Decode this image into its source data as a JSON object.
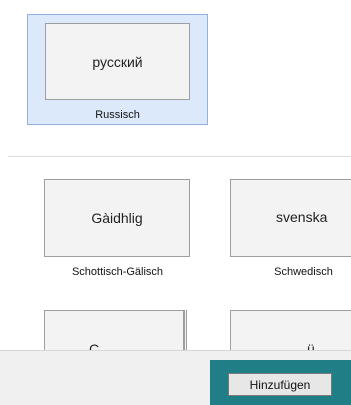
{
  "selected_language": {
    "native_name": "русский",
    "caption": "Russisch"
  },
  "languages": [
    {
      "native_name": "Gàidhlig",
      "caption": "Schottisch-Gälisch"
    },
    {
      "native_name": "svenska",
      "caption": "Schwedisch"
    }
  ],
  "partial_tiles": [
    {
      "native_name_fragment": "C"
    },
    {
      "native_name_fragment": "ü"
    }
  ],
  "actions": {
    "add_label": "Hinzufügen"
  },
  "colors": {
    "selection_background": "#dbe9fb",
    "selection_border": "#8fb2de",
    "focus_highlight": "#1f7e86"
  }
}
